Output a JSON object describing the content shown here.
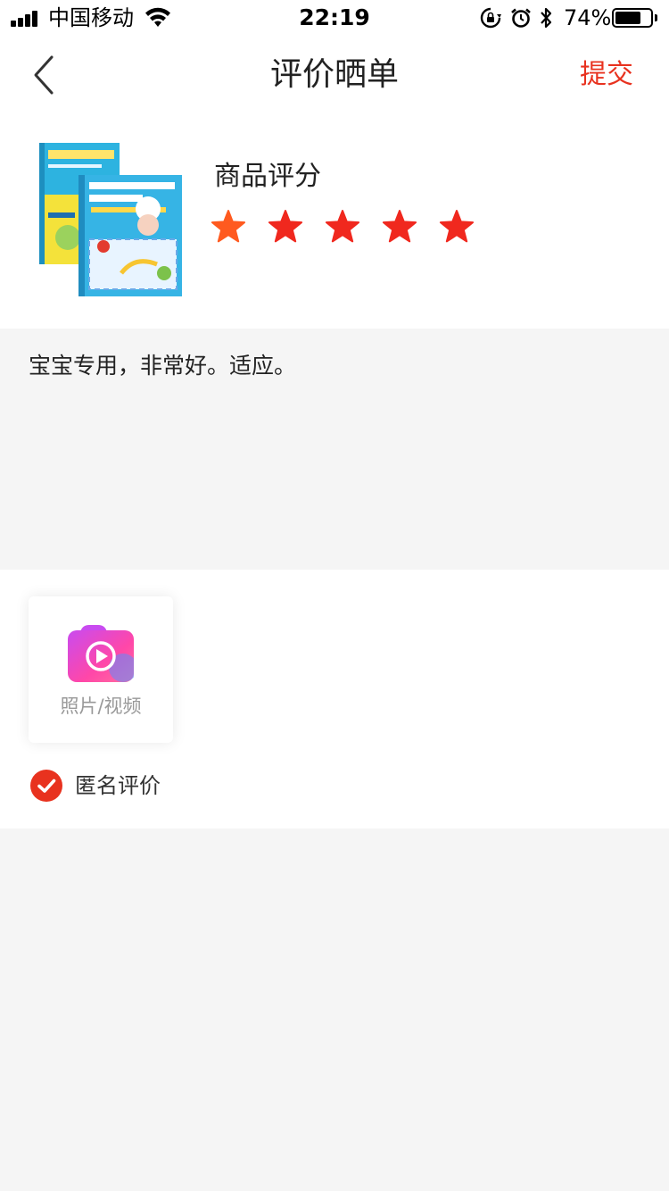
{
  "status_bar": {
    "carrier": "中国移动",
    "time": "22:19",
    "battery_percent": "74%",
    "battery_level": 0.74,
    "icons": [
      "signal-icon",
      "wifi-icon",
      "rotation-lock-icon",
      "alarm-icon",
      "bluetooth-icon",
      "battery-icon"
    ]
  },
  "nav": {
    "back_icon": "chevron-left-icon",
    "title": "评价晒单",
    "submit_label": "提交"
  },
  "colors": {
    "accent": "#e8321f",
    "star_gradient": [
      "#ff5a1f",
      "#f0281e",
      "#e8321f"
    ],
    "camera_gradient": [
      "#c94bf0",
      "#ff47a8",
      "#5b8cff"
    ]
  },
  "product": {
    "image_icon": "book-cover-image",
    "rating_label": "商品评分",
    "rating": 5,
    "max_rating": 5
  },
  "review": {
    "text": "宝宝专用，非常好。适应。"
  },
  "media": {
    "upload_icon": "camera-video-icon",
    "upload_label": "照片/视频"
  },
  "anonymous": {
    "checked": true,
    "label": "匿名评价"
  }
}
